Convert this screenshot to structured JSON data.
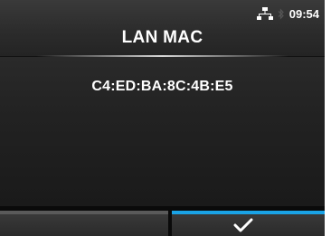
{
  "header": {
    "title": "LAN MAC",
    "time": "09:54",
    "icons": [
      "lan-network-icon",
      "bluetooth-icon"
    ]
  },
  "content": {
    "mac_address": "C4:ED:BA:8C:4B:E5"
  },
  "softkeys": {
    "left": {
      "label": "",
      "accent_color": "#5a5a5a"
    },
    "right": {
      "icon": "checkmark-icon",
      "accent_color": "#1aa3e6"
    }
  },
  "colors": {
    "accent": "#1aa3e6",
    "text": "#ffffff",
    "background": "#1a1a1a"
  }
}
